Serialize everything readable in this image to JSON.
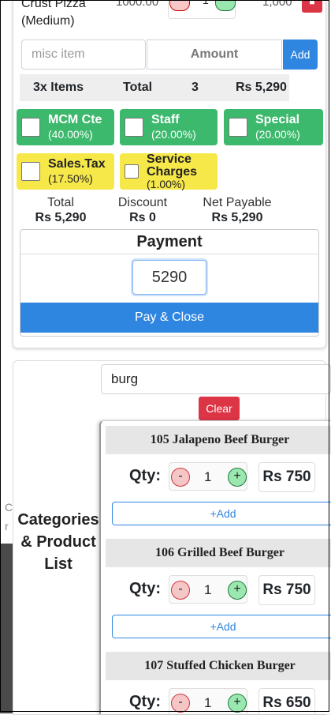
{
  "order": {
    "item_name": "Crust Pizza (Medium)",
    "item_price": "1000.00",
    "item_qty": "1",
    "item_total": "1,000"
  },
  "misc": {
    "placeholder": "misc item",
    "amount_placeholder": "Amount",
    "add_label": "Add"
  },
  "summary": {
    "items": "3x Items",
    "total_label": "Total",
    "count": "3",
    "amount": "Rs 5,290"
  },
  "discounts": [
    {
      "name": "MCM Cte",
      "percent": "(40.00%)"
    },
    {
      "name": "Staff",
      "percent": "(20.00%)"
    },
    {
      "name": "Special",
      "percent": "(20.00%)"
    },
    {
      "name": "Sales.Tax",
      "percent": "(17.50%)"
    },
    {
      "name": "Service Charges",
      "percent": "(1.00%)"
    }
  ],
  "totals": {
    "total_label": "Total",
    "total_value": "Rs 5,290",
    "discount_label": "Discount",
    "discount_value": "Rs 0",
    "net_label": "Net Payable",
    "net_value": "Rs 5,290"
  },
  "payment": {
    "title": "Payment",
    "value": "5290",
    "pay_label": "Pay & Close"
  },
  "products": {
    "search_value": "burg",
    "clear_label": "Clear",
    "section_label": "Categories & Product List",
    "qty_label": "Qty:",
    "add_label": "+Add",
    "items": [
      {
        "name": "105 Jalapeno Beef Burger",
        "qty": "1",
        "price": "Rs 750"
      },
      {
        "name": "106 Grilled Beef Burger",
        "qty": "1",
        "price": "Rs 750"
      },
      {
        "name": "107 Stuffed Chicken Burger",
        "qty": "1",
        "price": "Rs 650"
      }
    ]
  },
  "colors": {
    "primary": "#2f86e0",
    "danger": "#dc3545",
    "discount_green": "#3cb96c",
    "tax_yellow": "#f7e84a"
  }
}
